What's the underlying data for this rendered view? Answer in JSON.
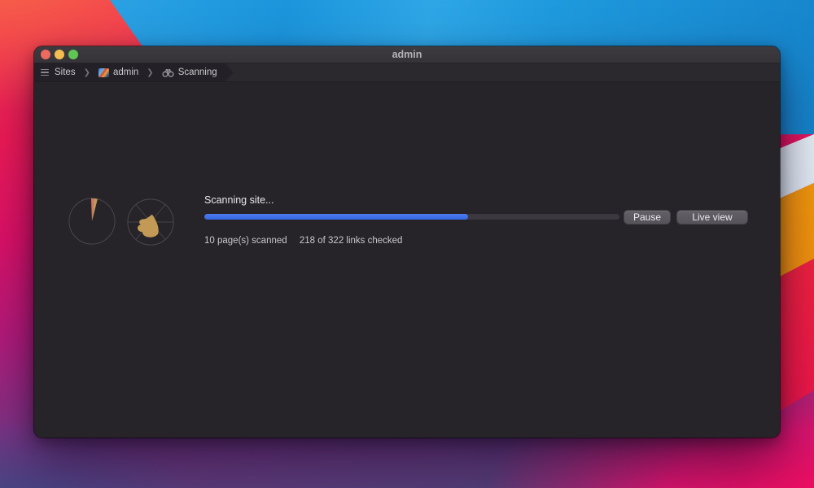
{
  "window": {
    "title": "admin",
    "breadcrumb": {
      "items": [
        {
          "icon": "list-icon",
          "label": "Sites"
        },
        {
          "icon": "site-favicon",
          "label": "admin"
        },
        {
          "icon": "binoculars-icon",
          "label": "Scanning"
        }
      ]
    },
    "scan": {
      "status": "Scanning site...",
      "progress_percent": 63.5,
      "pages_scanned": "10 page(s) scanned",
      "links_checked": "218 of 322 links checked",
      "buttons": {
        "pause": "Pause",
        "live_view": "Live view"
      }
    }
  },
  "icons": {
    "chevron_glyph": "❯"
  },
  "colors": {
    "accent_blue": "#3667e4",
    "pie_tan": "#c29a55",
    "pie_red": "#d3746b",
    "traffic_red": "#ed6a5f",
    "traffic_yellow": "#f5bd4f",
    "traffic_green": "#61c554"
  }
}
